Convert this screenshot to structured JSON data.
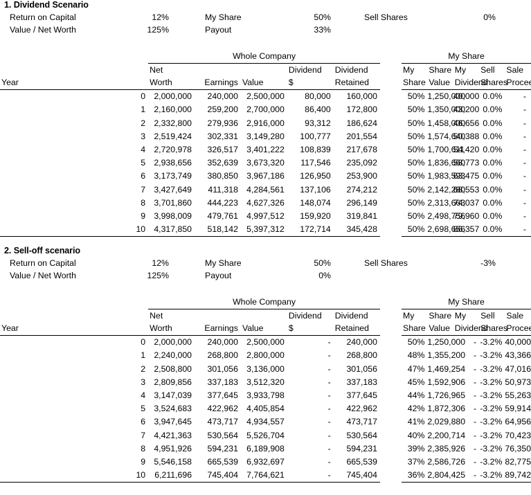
{
  "columns": {
    "group_whole": "Whole Company",
    "group_my": "My Share",
    "year": "Year",
    "net_worth_1": "Net",
    "net_worth_2": "Worth",
    "earnings": "Earnings",
    "value": "Value",
    "dividend_1": "Dividend",
    "dividend_2": "$",
    "retained_1": "Dividend",
    "retained_2": "Retained",
    "my_share_1": "My",
    "my_share_2": "Share",
    "share_value_1": "Share",
    "share_value_2": "Value",
    "my_dividend_1": "My",
    "my_dividend_2": "Dividend",
    "sell_shares_1": "Sell",
    "sell_shares_2": "Shares",
    "sale_proceeds_1": "Sale",
    "sale_proceeds_2": "Proceeds"
  },
  "scenario1": {
    "title": "1. Dividend Scenario",
    "params": {
      "return_on_capital_label": "Return on Capital",
      "return_on_capital_value": "12%",
      "value_net_worth_label": "Value / Net Worth",
      "value_net_worth_value": "125%",
      "my_share_label": "My Share",
      "my_share_value": "50%",
      "payout_label": "Payout",
      "payout_value": "33%",
      "sell_shares_label": "Sell Shares",
      "sell_shares_value": "0%"
    },
    "rows": [
      {
        "year": "0",
        "net_worth": "2,000,000",
        "earnings": "240,000",
        "value": "2,500,000",
        "dividend": "80,000",
        "retained": "160,000",
        "my_share": "50%",
        "share_value": "1,250,000",
        "my_dividend": "40,000",
        "sell_shares": "0.0%",
        "sale_proceeds": "-"
      },
      {
        "year": "1",
        "net_worth": "2,160,000",
        "earnings": "259,200",
        "value": "2,700,000",
        "dividend": "86,400",
        "retained": "172,800",
        "my_share": "50%",
        "share_value": "1,350,000",
        "my_dividend": "43,200",
        "sell_shares": "0.0%",
        "sale_proceeds": "-"
      },
      {
        "year": "2",
        "net_worth": "2,332,800",
        "earnings": "279,936",
        "value": "2,916,000",
        "dividend": "93,312",
        "retained": "186,624",
        "my_share": "50%",
        "share_value": "1,458,000",
        "my_dividend": "46,656",
        "sell_shares": "0.0%",
        "sale_proceeds": "-"
      },
      {
        "year": "3",
        "net_worth": "2,519,424",
        "earnings": "302,331",
        "value": "3,149,280",
        "dividend": "100,777",
        "retained": "201,554",
        "my_share": "50%",
        "share_value": "1,574,640",
        "my_dividend": "50,388",
        "sell_shares": "0.0%",
        "sale_proceeds": "-"
      },
      {
        "year": "4",
        "net_worth": "2,720,978",
        "earnings": "326,517",
        "value": "3,401,222",
        "dividend": "108,839",
        "retained": "217,678",
        "my_share": "50%",
        "share_value": "1,700,611",
        "my_dividend": "54,420",
        "sell_shares": "0.0%",
        "sale_proceeds": "-"
      },
      {
        "year": "5",
        "net_worth": "2,938,656",
        "earnings": "352,639",
        "value": "3,673,320",
        "dividend": "117,546",
        "retained": "235,092",
        "my_share": "50%",
        "share_value": "1,836,660",
        "my_dividend": "58,773",
        "sell_shares": "0.0%",
        "sale_proceeds": "-"
      },
      {
        "year": "6",
        "net_worth": "3,173,749",
        "earnings": "380,850",
        "value": "3,967,186",
        "dividend": "126,950",
        "retained": "253,900",
        "my_share": "50%",
        "share_value": "1,983,593",
        "my_dividend": "63,475",
        "sell_shares": "0.0%",
        "sale_proceeds": "-"
      },
      {
        "year": "7",
        "net_worth": "3,427,649",
        "earnings": "411,318",
        "value": "4,284,561",
        "dividend": "137,106",
        "retained": "274,212",
        "my_share": "50%",
        "share_value": "2,142,280",
        "my_dividend": "68,553",
        "sell_shares": "0.0%",
        "sale_proceeds": "-"
      },
      {
        "year": "8",
        "net_worth": "3,701,860",
        "earnings": "444,223",
        "value": "4,627,326",
        "dividend": "148,074",
        "retained": "296,149",
        "my_share": "50%",
        "share_value": "2,313,663",
        "my_dividend": "74,037",
        "sell_shares": "0.0%",
        "sale_proceeds": "-"
      },
      {
        "year": "9",
        "net_worth": "3,998,009",
        "earnings": "479,761",
        "value": "4,997,512",
        "dividend": "159,920",
        "retained": "319,841",
        "my_share": "50%",
        "share_value": "2,498,756",
        "my_dividend": "79,960",
        "sell_shares": "0.0%",
        "sale_proceeds": "-"
      },
      {
        "year": "10",
        "net_worth": "4,317,850",
        "earnings": "518,142",
        "value": "5,397,312",
        "dividend": "172,714",
        "retained": "345,428",
        "my_share": "50%",
        "share_value": "2,698,656",
        "my_dividend": "86,357",
        "sell_shares": "0.0%",
        "sale_proceeds": "-"
      }
    ]
  },
  "scenario2": {
    "title": "2. Sell-off scenario",
    "params": {
      "return_on_capital_label": "Return on Capital",
      "return_on_capital_value": "12%",
      "value_net_worth_label": "Value / Net Worth",
      "value_net_worth_value": "125%",
      "my_share_label": "My Share",
      "my_share_value": "50%",
      "payout_label": "Payout",
      "payout_value": "0%",
      "sell_shares_label": "Sell Shares",
      "sell_shares_value": "-3%"
    },
    "rows": [
      {
        "year": "0",
        "net_worth": "2,000,000",
        "earnings": "240,000",
        "value": "2,500,000",
        "dividend": "-",
        "retained": "240,000",
        "my_share": "50%",
        "share_value": "1,250,000",
        "my_dividend": "-",
        "sell_shares": "-3.2%",
        "sale_proceeds": "40,000"
      },
      {
        "year": "1",
        "net_worth": "2,240,000",
        "earnings": "268,800",
        "value": "2,800,000",
        "dividend": "-",
        "retained": "268,800",
        "my_share": "48%",
        "share_value": "1,355,200",
        "my_dividend": "-",
        "sell_shares": "-3.2%",
        "sale_proceeds": "43,366"
      },
      {
        "year": "2",
        "net_worth": "2,508,800",
        "earnings": "301,056",
        "value": "3,136,000",
        "dividend": "-",
        "retained": "301,056",
        "my_share": "47%",
        "share_value": "1,469,254",
        "my_dividend": "-",
        "sell_shares": "-3.2%",
        "sale_proceeds": "47,016"
      },
      {
        "year": "3",
        "net_worth": "2,809,856",
        "earnings": "337,183",
        "value": "3,512,320",
        "dividend": "-",
        "retained": "337,183",
        "my_share": "45%",
        "share_value": "1,592,906",
        "my_dividend": "-",
        "sell_shares": "-3.2%",
        "sale_proceeds": "50,973"
      },
      {
        "year": "4",
        "net_worth": "3,147,039",
        "earnings": "377,645",
        "value": "3,933,798",
        "dividend": "-",
        "retained": "377,645",
        "my_share": "44%",
        "share_value": "1,726,965",
        "my_dividend": "-",
        "sell_shares": "-3.2%",
        "sale_proceeds": "55,263"
      },
      {
        "year": "5",
        "net_worth": "3,524,683",
        "earnings": "422,962",
        "value": "4,405,854",
        "dividend": "-",
        "retained": "422,962",
        "my_share": "42%",
        "share_value": "1,872,306",
        "my_dividend": "-",
        "sell_shares": "-3.2%",
        "sale_proceeds": "59,914"
      },
      {
        "year": "6",
        "net_worth": "3,947,645",
        "earnings": "473,717",
        "value": "4,934,557",
        "dividend": "-",
        "retained": "473,717",
        "my_share": "41%",
        "share_value": "2,029,880",
        "my_dividend": "-",
        "sell_shares": "-3.2%",
        "sale_proceeds": "64,956"
      },
      {
        "year": "7",
        "net_worth": "4,421,363",
        "earnings": "530,564",
        "value": "5,526,704",
        "dividend": "-",
        "retained": "530,564",
        "my_share": "40%",
        "share_value": "2,200,714",
        "my_dividend": "-",
        "sell_shares": "-3.2%",
        "sale_proceeds": "70,423"
      },
      {
        "year": "8",
        "net_worth": "4,951,926",
        "earnings": "594,231",
        "value": "6,189,908",
        "dividend": "-",
        "retained": "594,231",
        "my_share": "39%",
        "share_value": "2,385,926",
        "my_dividend": "-",
        "sell_shares": "-3.2%",
        "sale_proceeds": "76,350"
      },
      {
        "year": "9",
        "net_worth": "5,546,158",
        "earnings": "665,539",
        "value": "6,932,697",
        "dividend": "-",
        "retained": "665,539",
        "my_share": "37%",
        "share_value": "2,586,726",
        "my_dividend": "-",
        "sell_shares": "-3.2%",
        "sale_proceeds": "82,775"
      },
      {
        "year": "10",
        "net_worth": "6,211,696",
        "earnings": "745,404",
        "value": "7,764,621",
        "dividend": "-",
        "retained": "745,404",
        "my_share": "36%",
        "share_value": "2,804,425",
        "my_dividend": "-",
        "sell_shares": "-3.2%",
        "sale_proceeds": "89,742"
      }
    ]
  }
}
